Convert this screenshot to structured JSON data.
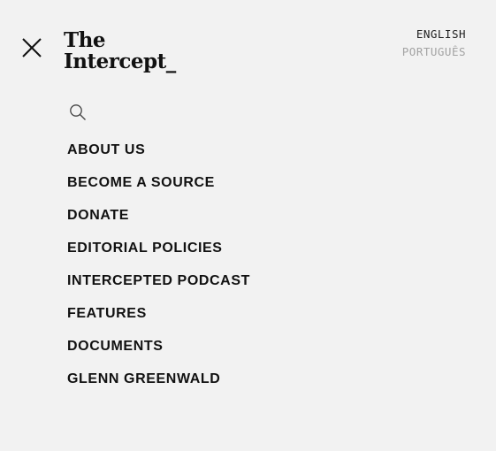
{
  "header": {
    "logo_line1": "The",
    "logo_line2": "Intercept_"
  },
  "language": {
    "options": [
      {
        "label": "ENGLISH",
        "active": true
      },
      {
        "label": "PORTUGUÊS",
        "active": false
      }
    ]
  },
  "icons": {
    "close": "close-icon",
    "search": "search-icon"
  },
  "menu": {
    "items": [
      {
        "label": "ABOUT US"
      },
      {
        "label": "BECOME A SOURCE"
      },
      {
        "label": "DONATE"
      },
      {
        "label": "EDITORIAL POLICIES"
      },
      {
        "label": "INTERCEPTED PODCAST"
      },
      {
        "label": "FEATURES"
      },
      {
        "label": "DOCUMENTS"
      },
      {
        "label": "GLENN GREENWALD"
      }
    ]
  },
  "colors": {
    "background": "#f2f2f2",
    "text": "#111111",
    "inactive_language": "#a3a3a3"
  }
}
